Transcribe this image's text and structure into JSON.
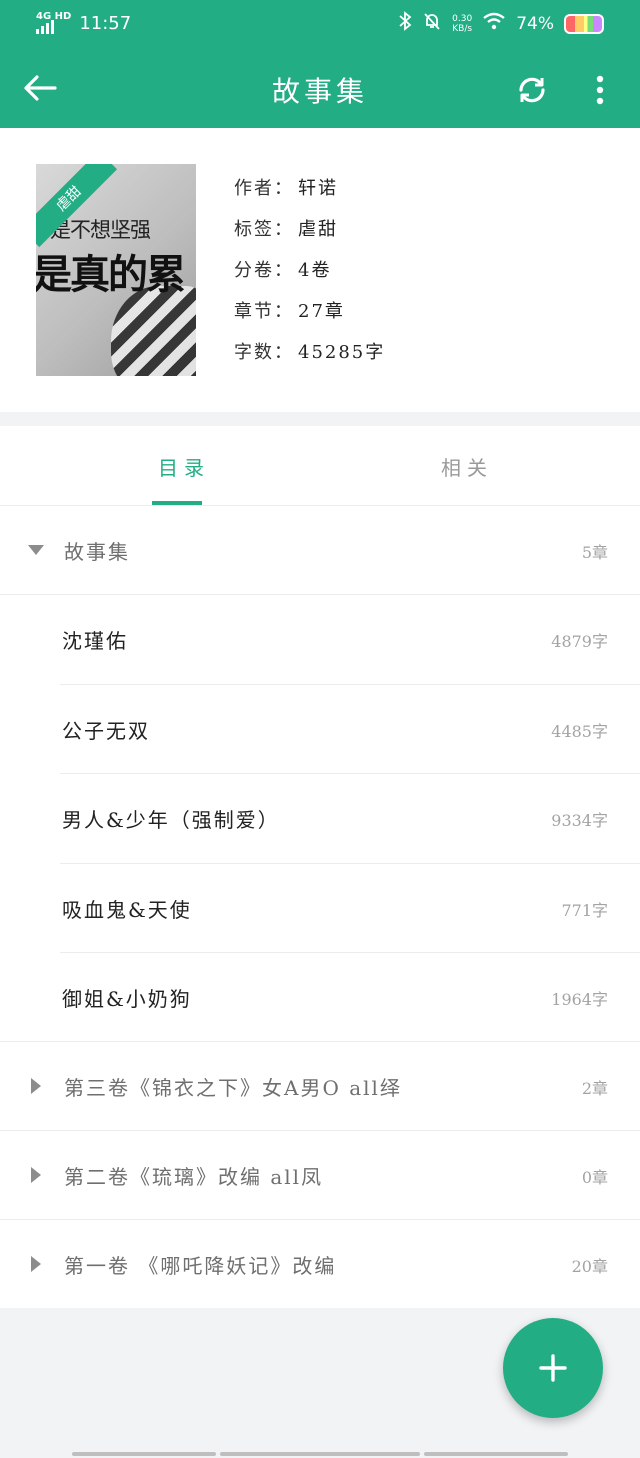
{
  "status_bar": {
    "network": "4G HD",
    "time": "11:57",
    "speed_value": "0.30",
    "speed_unit": "KB/s",
    "battery": "74%"
  },
  "appbar": {
    "title": "故事集",
    "back_icon": "arrow-left-icon",
    "sync_icon": "refresh-icon",
    "more_icon": "more-vertical-icon"
  },
  "book": {
    "cover": {
      "ribbon_tag": "虐甜",
      "line1": "不是不想坚强",
      "line2": "是真的累"
    },
    "meta": [
      {
        "key": "作者：",
        "value": "轩诺"
      },
      {
        "key": "标签：",
        "value": "虐甜"
      },
      {
        "key": "分卷：",
        "value": "4卷"
      },
      {
        "key": "章节：",
        "value": "27章"
      },
      {
        "key": "字数：",
        "value": "45285字"
      }
    ]
  },
  "tabs": [
    {
      "label": "目录",
      "active": true
    },
    {
      "label": "相关",
      "active": false
    }
  ],
  "catalog": [
    {
      "type": "volume",
      "expanded": true,
      "name": "故事集",
      "count": "5章"
    },
    {
      "type": "chapter",
      "name": "沈瑾佑",
      "count": "4879字"
    },
    {
      "type": "chapter",
      "name": "公子无双",
      "count": "4485字"
    },
    {
      "type": "chapter",
      "name": "男人&少年（强制爱）",
      "count": "9334字"
    },
    {
      "type": "chapter",
      "name": "吸血鬼&天使",
      "count": "771字"
    },
    {
      "type": "chapter",
      "name": "御姐&小奶狗",
      "count": "1964字"
    },
    {
      "type": "volume",
      "expanded": false,
      "name": "第三卷《锦衣之下》女A男O all绎",
      "count": "2章"
    },
    {
      "type": "volume",
      "expanded": false,
      "name": "第二卷《琉璃》改编  all凤",
      "count": "0章"
    },
    {
      "type": "volume",
      "expanded": false,
      "name": "第一卷  《哪吒降妖记》改编",
      "count": "20章"
    }
  ],
  "fab": {
    "icon": "plus-icon"
  },
  "colors": {
    "accent": "#23ad84",
    "muted_text": "#a3a3a3",
    "background": "#f2f3f5"
  }
}
